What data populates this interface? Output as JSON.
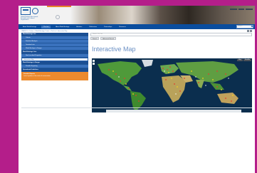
{
  "header": {
    "logo_text": "United Nations Educational, Scientific and Cultural Organization",
    "brand_color": "#0a4d9e",
    "accent_color": "#e8852b"
  },
  "nav": {
    "items": [
      {
        "label": "About World Heritage",
        "active": false
      },
      {
        "label": "The List",
        "active": true
      },
      {
        "label": "About World Heritage",
        "active": false
      },
      {
        "label": "Activities",
        "active": false
      },
      {
        "label": "Publications",
        "active": false
      },
      {
        "label": "Partnerships",
        "active": false
      },
      {
        "label": "Resources",
        "active": false
      }
    ],
    "search_placeholder": "Search"
  },
  "breadcrumb": "UNESCO » Culture » World Heritage Centre » The List » Interactive Map",
  "sidebar": {
    "items": [
      {
        "label": "World Heritage List",
        "kind": "section"
      },
      {
        "label": "Criteria",
        "kind": "sub"
      },
      {
        "label": "Statistical Analysis",
        "kind": "sub"
      },
      {
        "label": "Tentative Lists",
        "kind": "sub"
      },
      {
        "label": "World Heritage in Danger",
        "kind": "sub"
      },
      {
        "label": "World Heritage Lists",
        "kind": "section"
      },
      {
        "label": "New Inscribed Properties",
        "kind": "sub"
      },
      {
        "label": "Interactive Map",
        "kind": "selected"
      },
      {
        "label": "World Heritage in Danger",
        "kind": "section"
      },
      {
        "label": "Periodic Reporting",
        "kind": "sub"
      },
      {
        "label": "Operational Guidelines",
        "kind": "section"
      }
    ],
    "promo_title": "Periodic Reports",
    "promo_text": "Latest updates of the state of conservation"
  },
  "main": {
    "search_placeholder": "Search The List",
    "buttons": [
      "Search",
      "Advanced Search"
    ],
    "title": "Interactive Map",
    "map_layer_buttons": [
      "Map",
      "Satellite"
    ]
  },
  "icons": [
    "unesco-emblem-icon",
    "world-heritage-emblem-icon",
    "globe-icon",
    "search-icon",
    "zoom-in-icon",
    "zoom-out-icon"
  ]
}
